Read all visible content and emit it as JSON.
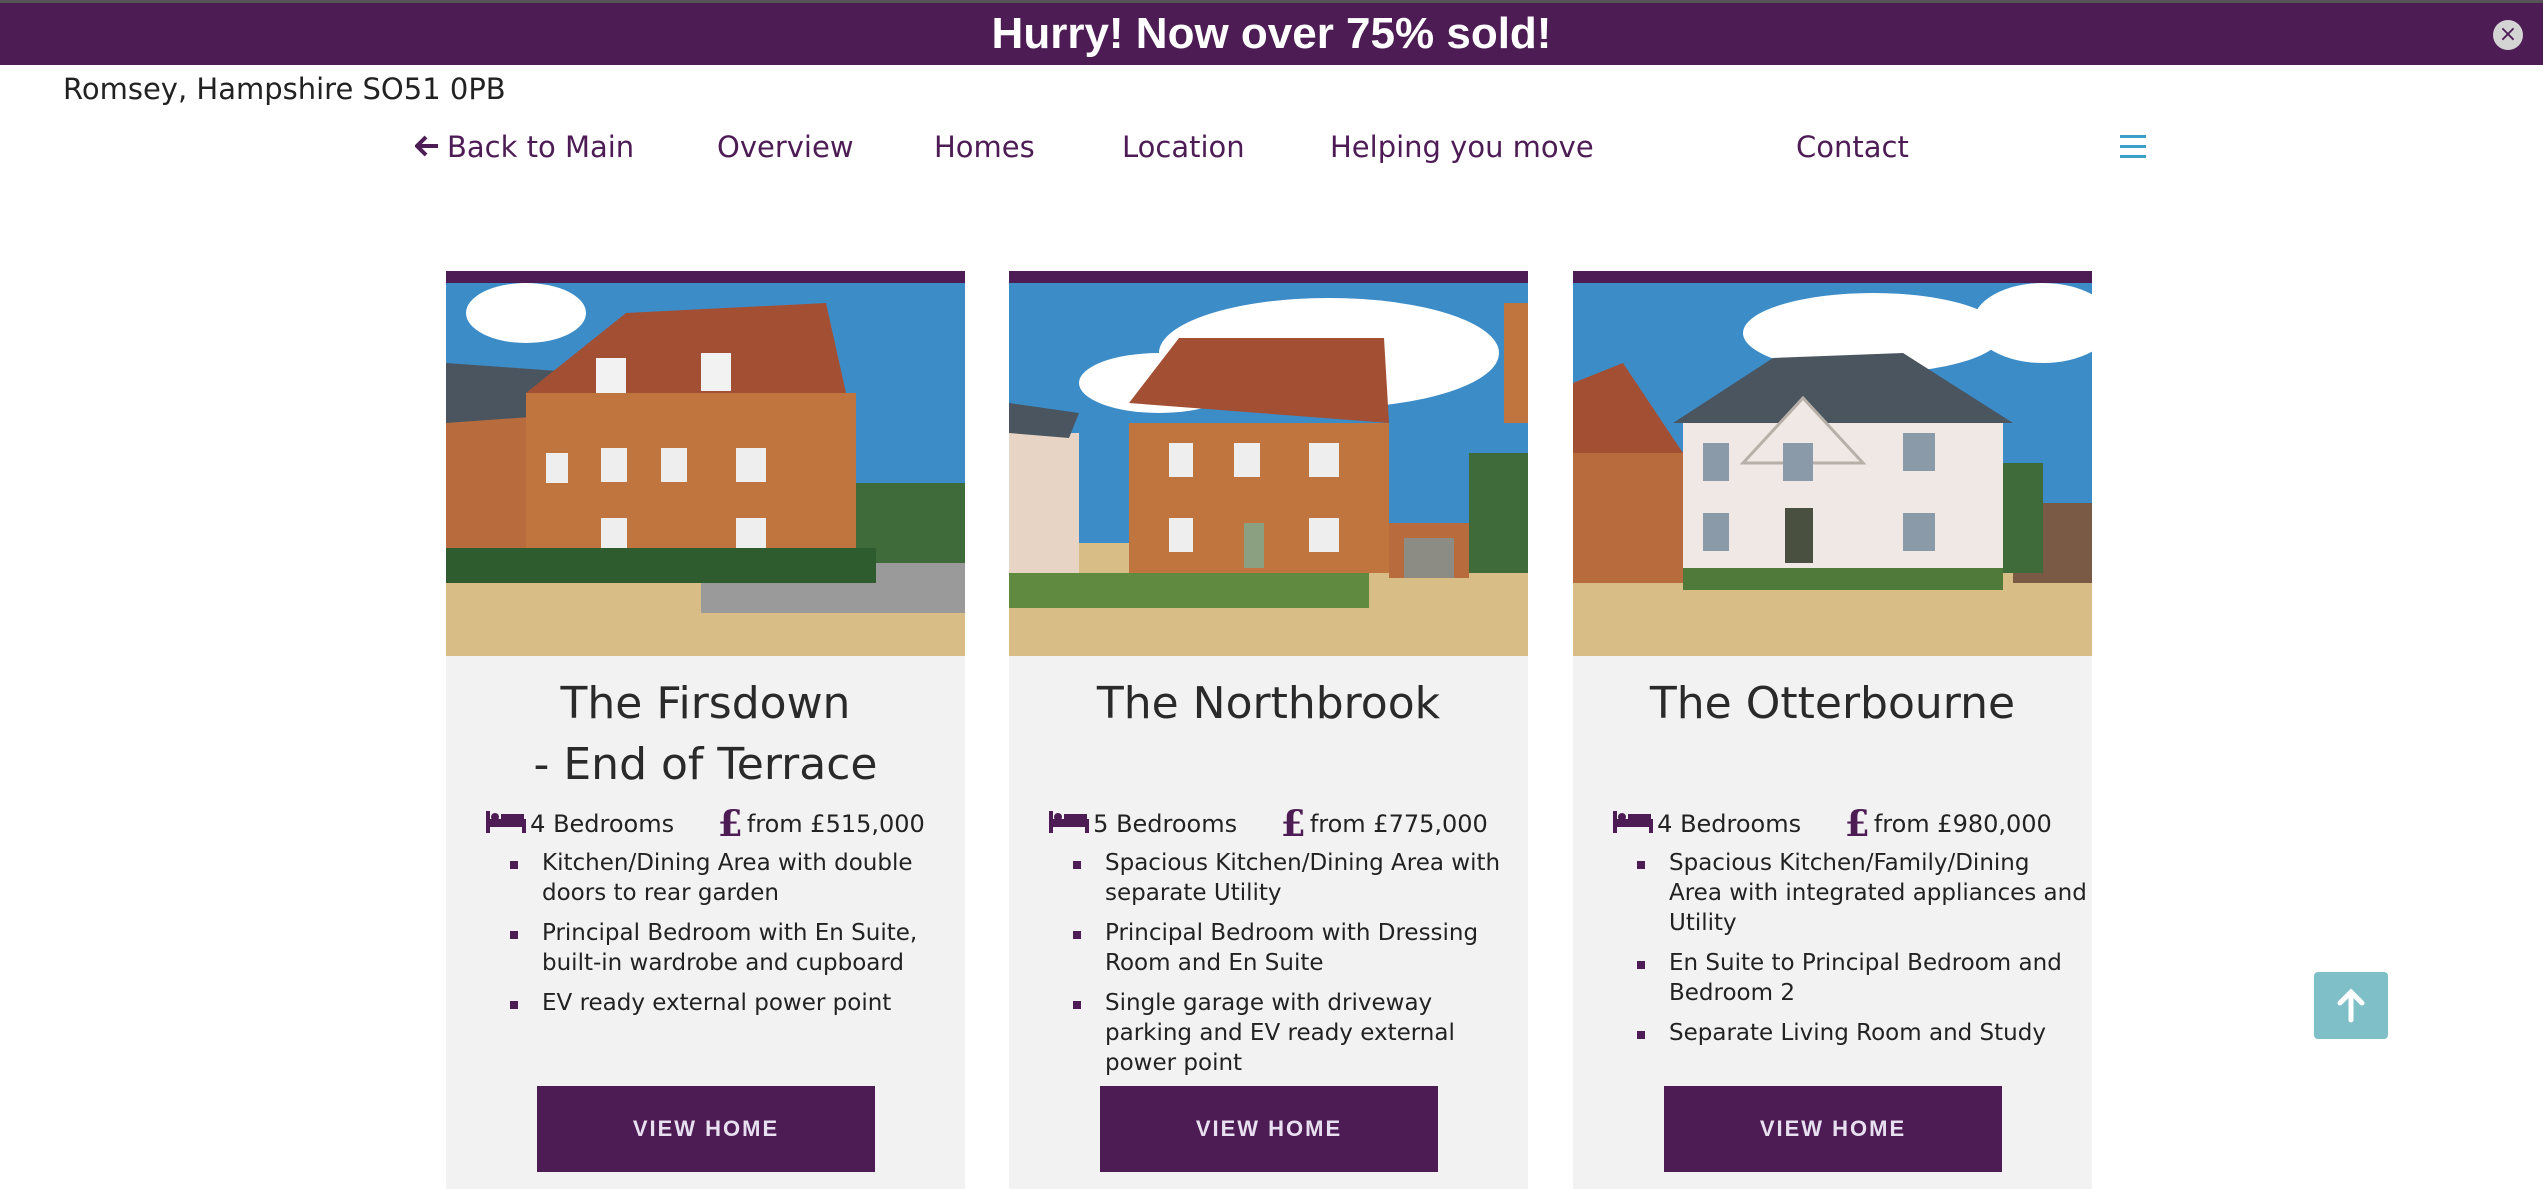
{
  "banner": {
    "text": "Hurry! Now over 75% sold!",
    "close_icon": "close-icon"
  },
  "address": "Romsey, Hampshire SO51 0PB",
  "nav": {
    "back": "Back to Main",
    "items": [
      "Overview",
      "Homes",
      "Location",
      "Helping you move",
      "Contact"
    ],
    "menu_icon": "hamburger-menu-icon"
  },
  "homes": [
    {
      "title_line1": "The Firsdown",
      "title_line2": "- End of Terrace",
      "bedrooms": "4 Bedrooms",
      "price": "from £515,000",
      "features": [
        "Kitchen/Dining Area with double doors to rear garden",
        "Principal Bedroom with En Suite, built-in wardrobe and cupboard",
        "EV ready external power point"
      ],
      "button": "VIEW HOME"
    },
    {
      "title_line1": "The Northbrook",
      "title_line2": "",
      "bedrooms": "5 Bedrooms",
      "price": "from £775,000",
      "features": [
        "Spacious Kitchen/Dining Area with separate Utility",
        "Principal Bedroom with Dressing Room and En Suite",
        "Single garage with driveway parking and EV ready external power point"
      ],
      "button": "VIEW HOME"
    },
    {
      "title_line1": "The Otterbourne",
      "title_line2": "",
      "bedrooms": "4 Bedrooms",
      "price": "from £980,000",
      "features": [
        "Spacious Kitchen/Family/Dining Area with integrated appliances and Utility",
        "En Suite to Principal Bedroom and Bedroom 2",
        "Separate Living Room and Study"
      ],
      "button": "VIEW HOME"
    }
  ],
  "colors": {
    "brand": "#4d1c55",
    "scroll_top": "#7fbfc7",
    "menu_icon": "#3aa0c8"
  },
  "scroll_top_icon": "arrow-up-icon"
}
